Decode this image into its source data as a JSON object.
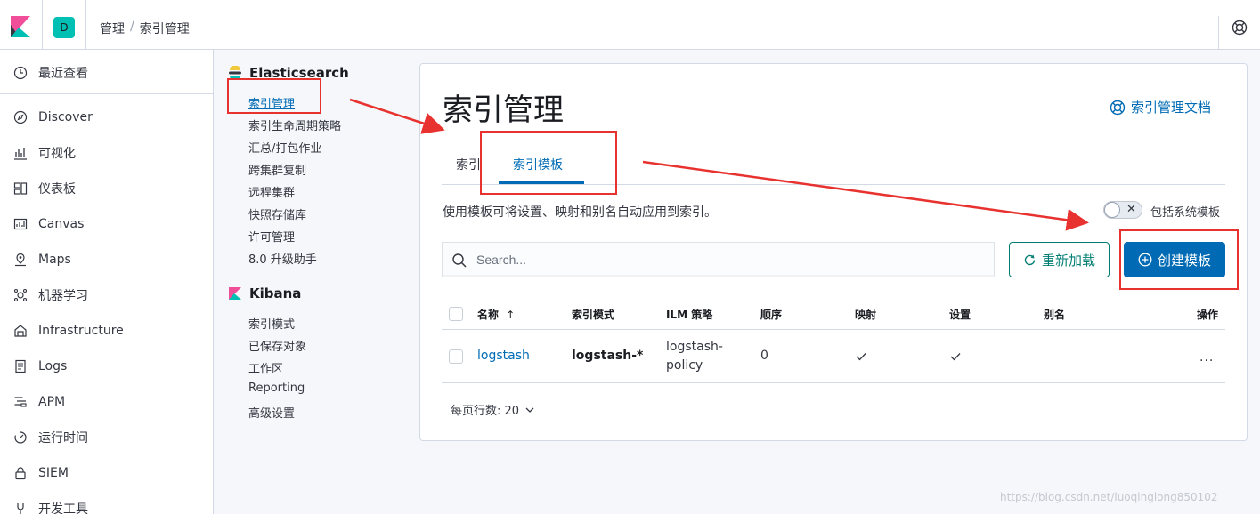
{
  "header": {
    "space_initial": "D",
    "breadcrumb": [
      "管理",
      "索引管理"
    ],
    "breadcrumb_sep": "/"
  },
  "leftnav": {
    "items": [
      {
        "label": "最近查看",
        "icon": "clock-icon"
      },
      {
        "label": "Discover",
        "icon": "compass-icon"
      },
      {
        "label": "可视化",
        "icon": "visualize-icon"
      },
      {
        "label": "仪表板",
        "icon": "dashboard-icon"
      },
      {
        "label": "Canvas",
        "icon": "canvas-icon"
      },
      {
        "label": "Maps",
        "icon": "maps-icon"
      },
      {
        "label": "机器学习",
        "icon": "ml-icon"
      },
      {
        "label": "Infrastructure",
        "icon": "infrastructure-icon"
      },
      {
        "label": "Logs",
        "icon": "logs-icon"
      },
      {
        "label": "APM",
        "icon": "apm-icon"
      },
      {
        "label": "运行时间",
        "icon": "uptime-icon"
      },
      {
        "label": "SIEM",
        "icon": "siem-icon"
      },
      {
        "label": "开发工具",
        "icon": "devtools-icon"
      }
    ]
  },
  "mgmt": {
    "elasticsearch_title": "Elasticsearch",
    "elasticsearch_links": [
      "索引管理",
      "索引生命周期策略",
      "汇总/打包作业",
      "跨集群复制",
      "远程集群",
      "快照存储库",
      "许可管理",
      "8.0 升级助手"
    ],
    "kibana_title": "Kibana",
    "kibana_links": [
      "索引模式",
      "已保存对象",
      "工作区",
      "Reporting",
      "高级设置"
    ]
  },
  "main": {
    "title": "索引管理",
    "docs_link": "索引管理文档",
    "tabs": [
      "索引",
      "索引模板"
    ],
    "description": "使用模板可将设置、映射和别名自动应用到索引。",
    "toggle_label": "包括系统模板",
    "search_placeholder": "Search...",
    "reload_label": "重新加载",
    "create_label": "创建模板",
    "columns": [
      "名称",
      "索引模式",
      "ILM 策略",
      "顺序",
      "映射",
      "设置",
      "别名",
      "操作"
    ],
    "rows": [
      {
        "name": "logstash",
        "pattern": "logstash-*",
        "ilm_line1": "logstash-",
        "ilm_line2": "policy",
        "order": "0",
        "mapping": true,
        "settings": true,
        "aliases": ""
      }
    ],
    "pager_label": "每页行数: 20"
  },
  "colors": {
    "primary": "#006bb4",
    "secondary": "#017d73",
    "annotation_red": "#e8322f"
  },
  "watermark": "https://blog.csdn.net/luoqinglong850102"
}
